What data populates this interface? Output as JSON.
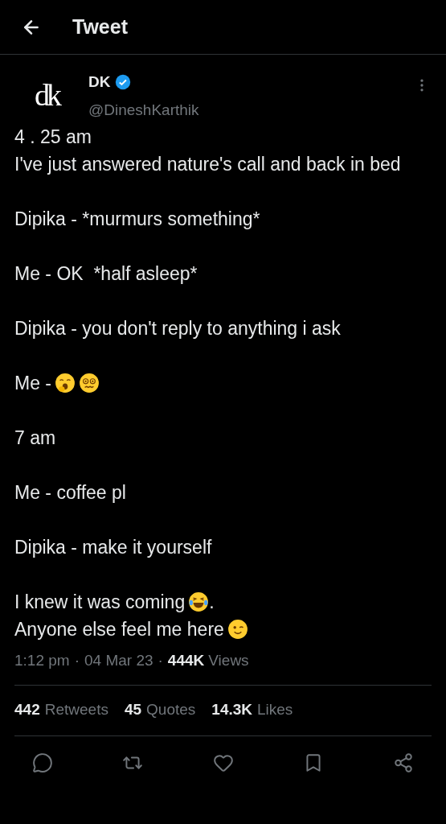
{
  "header": {
    "title": "Tweet"
  },
  "author": {
    "avatar_text": "dk",
    "name": "DK",
    "verified": true,
    "handle": "@DineshKarthik"
  },
  "paragraphs": [
    [
      {
        "text": "4 . 25 am",
        "kind": "plain"
      },
      {
        "text": "I've just answered nature's call and back in bed",
        "kind": "plain"
      }
    ],
    [
      {
        "text": "Dipika - *murmurs something*",
        "kind": "plain"
      }
    ],
    [
      {
        "text": "Me - OK  *half asleep*",
        "kind": "plain"
      }
    ],
    [
      {
        "text": "Dipika - you don't reply to anything i ask",
        "kind": "plain"
      }
    ],
    [
      {
        "text": "Me -",
        "kind": "yawn-dizzy"
      }
    ],
    [
      {
        "text": "7 am",
        "kind": "plain"
      }
    ],
    [
      {
        "text": "Me - coffee pl",
        "kind": "plain"
      }
    ],
    [
      {
        "text": "Dipika - make it yourself",
        "kind": "plain"
      }
    ],
    [
      {
        "text": "I knew it was coming",
        "kind": "laugh",
        "suffix": "."
      },
      {
        "text": "Anyone else feel me here",
        "kind": "wink"
      }
    ]
  ],
  "meta": {
    "time": "1:12 pm",
    "separator": "·",
    "date": "04 Mar 23",
    "views_count": "444K",
    "views_label": "Views"
  },
  "stats": [
    {
      "count": "442",
      "label": "Retweets"
    },
    {
      "count": "45",
      "label": "Quotes"
    },
    {
      "count": "14.3K",
      "label": "Likes"
    }
  ],
  "actions": [
    {
      "kind": "reply"
    },
    {
      "kind": "retweet"
    },
    {
      "kind": "like"
    },
    {
      "kind": "bookmark"
    },
    {
      "kind": "share"
    }
  ]
}
